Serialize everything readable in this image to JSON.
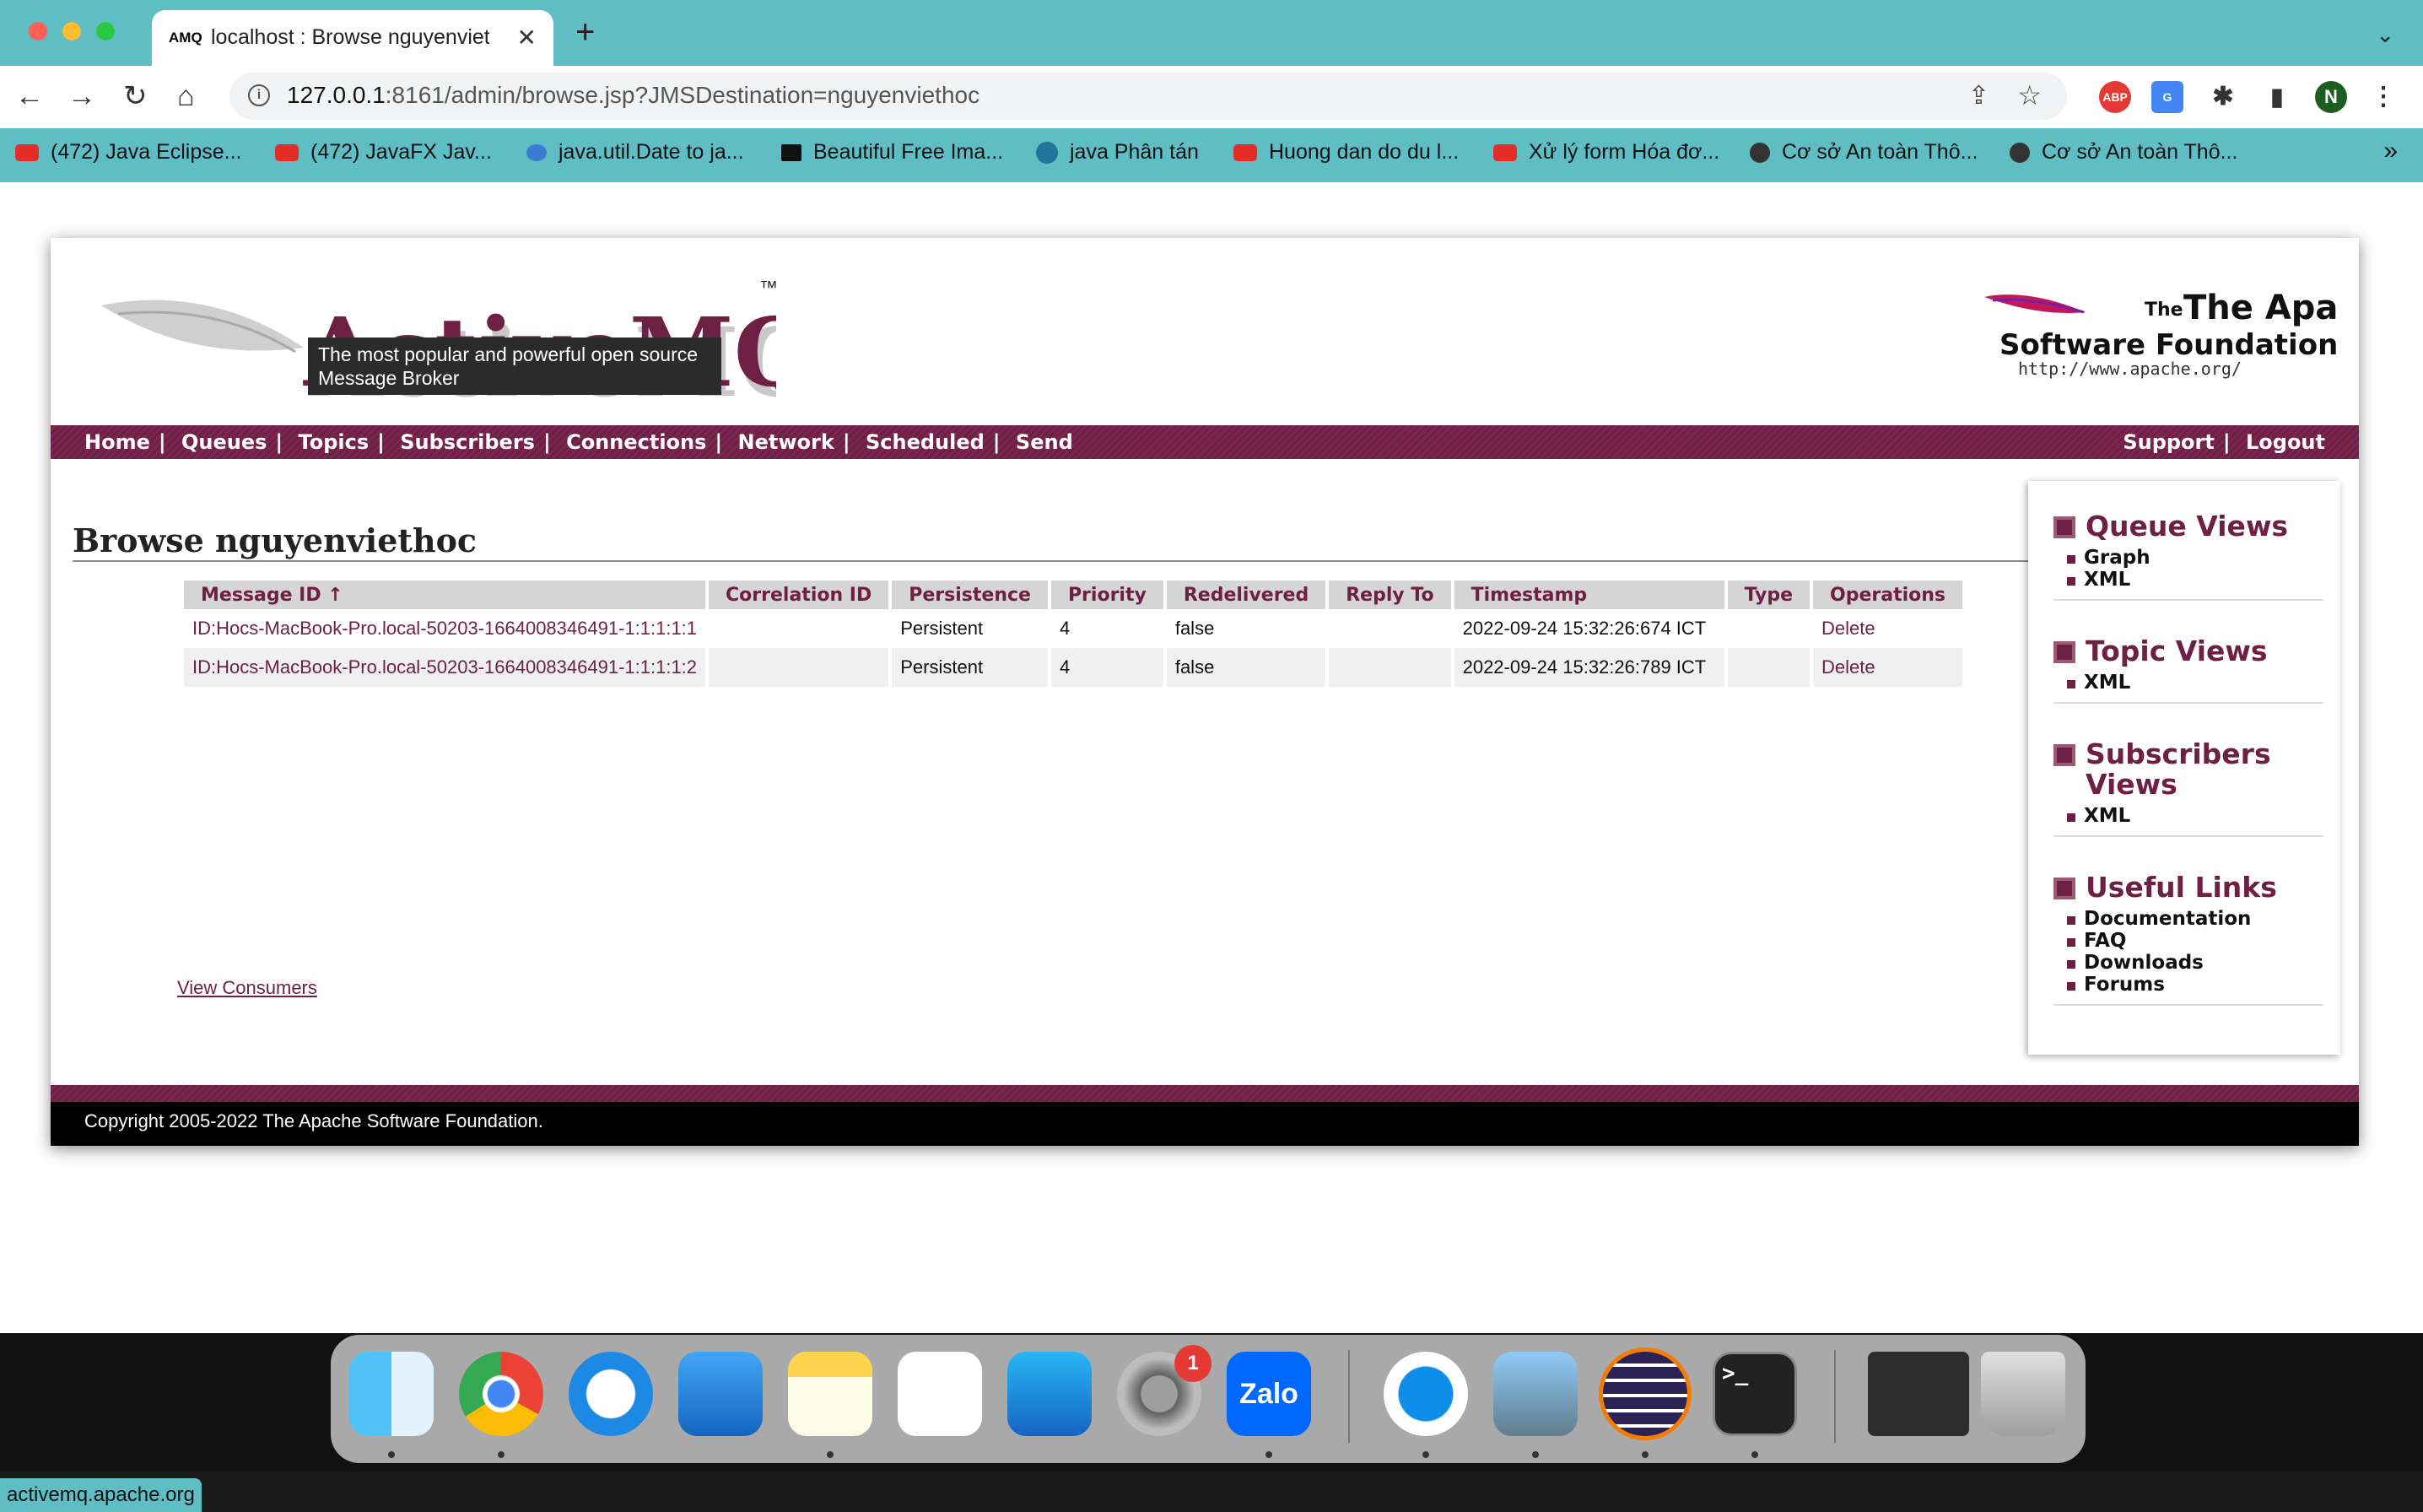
{
  "browser": {
    "tab_title": "localhost : Browse nguyenviet",
    "tab_favicon": "AMQ",
    "url_host": "127.0.0.1",
    "url_path": ":8161/admin/browse.jsp?JMSDestination=nguyenviethoc",
    "profile_initial": "N",
    "bookmarks": [
      "(472) Java Eclipse...",
      "(472) JavaFX Jav...",
      "java.util.Date to ja...",
      "Beautiful Free Ima...",
      "java Phân tán",
      "Huong dan do du l...",
      "Xử lý form Hóa đơ...",
      "Cơ sở An toàn Thô...",
      "Cơ sở An toàn Thô..."
    ],
    "status_url": "activemq.apache.org"
  },
  "header": {
    "logo_text": "ActiveMQ",
    "trademark": "™",
    "tooltip": "The most popular and powerful open source Message Broker",
    "apache_line1": "The Apache",
    "apache_line2": "Software Foundation",
    "apache_url": "http://www.apache.org/"
  },
  "nav": {
    "left": [
      "Home",
      "Queues",
      "Topics",
      "Subscribers",
      "Connections",
      "Network",
      "Scheduled",
      "Send"
    ],
    "right": [
      "Support",
      "Logout"
    ],
    "separator": "|"
  },
  "main": {
    "title": "Browse nguyenviethoc",
    "columns": [
      "Message ID ↑",
      "Correlation ID",
      "Persistence",
      "Priority",
      "Redelivered",
      "Reply To",
      "Timestamp",
      "Type",
      "Operations"
    ],
    "rows": [
      {
        "message_id": "ID:Hocs-MacBook-Pro.local-50203-1664008346491-1:1:1:1:1",
        "correlation_id": "",
        "persistence": "Persistent",
        "priority": "4",
        "redelivered": "false",
        "reply_to": "",
        "timestamp": "2022-09-24 15:32:26:674 ICT",
        "type": "",
        "operation": "Delete"
      },
      {
        "message_id": "ID:Hocs-MacBook-Pro.local-50203-1664008346491-1:1:1:1:2",
        "correlation_id": "",
        "persistence": "Persistent",
        "priority": "4",
        "redelivered": "false",
        "reply_to": "",
        "timestamp": "2022-09-24 15:32:26:789 ICT",
        "type": "",
        "operation": "Delete"
      }
    ],
    "view_consumers": "View Consumers"
  },
  "sidebar": {
    "queue_views": {
      "title": "Queue Views",
      "links": [
        "Graph",
        "XML"
      ]
    },
    "topic_views": {
      "title": "Topic Views",
      "links": [
        "XML"
      ]
    },
    "subscribers_views": {
      "title": "Subscribers Views",
      "links": [
        "XML"
      ]
    },
    "useful_links": {
      "title": "Useful Links",
      "links": [
        "Documentation",
        "FAQ",
        "Downloads",
        "Forums"
      ]
    }
  },
  "footer": {
    "copyright": "Copyright 2005-2022 The Apache Software Foundation."
  },
  "dock": {
    "settings_badge": "1",
    "zalo_label": "Zalo"
  },
  "colors": {
    "accent": "#6d1f44",
    "chrome": "#5fbdc4"
  }
}
